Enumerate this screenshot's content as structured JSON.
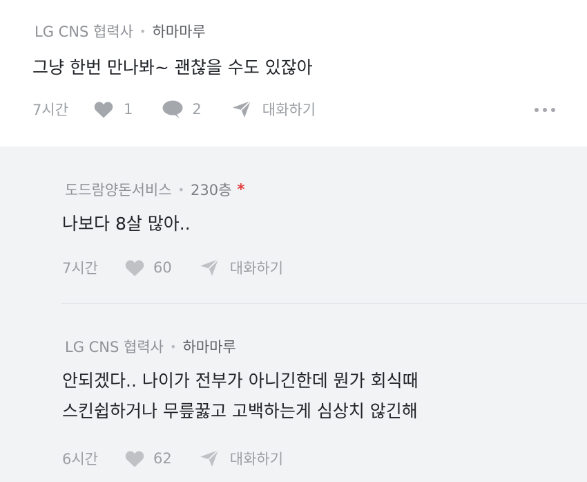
{
  "comment": {
    "company": "LG CNS 협력사",
    "nickname": "하마마루",
    "lines": [
      "그냥 한번 만나봐~ 괜찮을 수도 있잖아"
    ],
    "time": "7시간",
    "likes": "1",
    "replies": "2",
    "reply_action": "대화하기"
  },
  "replies": [
    {
      "company": "도드람양돈서비스",
      "nickname": "230층",
      "author_marker": "*",
      "lines": [
        "나보다 8살 많아.."
      ],
      "time": "7시간",
      "likes": "60",
      "reply_action": "대화하기"
    },
    {
      "company": "LG CNS 협력사",
      "nickname": "하마마루",
      "lines": [
        "안되겠다.. 나이가 전부가 아니긴한데 뭔가 회식때",
        "스킨쉽하거나 무릎꿇고 고백하는게 심상치 않긴해"
      ],
      "time": "6시간",
      "likes": "62",
      "reply_action": "대화하기"
    }
  ],
  "icons": {
    "like": "heart-icon",
    "comment": "speech-bubble-icon",
    "reply": "paper-plane-icon",
    "more": "more-dots-icon"
  },
  "colors": {
    "reply_background": "#f2f3f5",
    "author_marker": "#e23e3e",
    "icon_gray": "#a4a7ac"
  }
}
